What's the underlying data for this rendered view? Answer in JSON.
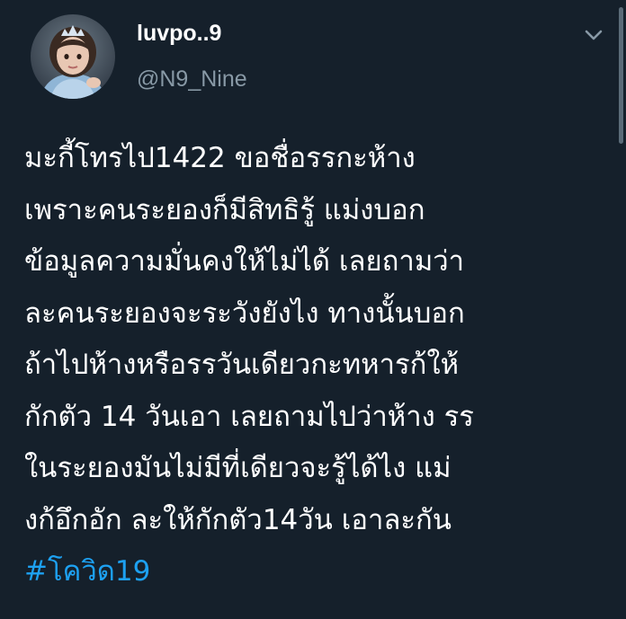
{
  "author": {
    "display_name": "luvpo..9",
    "handle": "@N9_Nine",
    "avatar_icon": "profile-photo"
  },
  "menu": {
    "icon": "chevron-down-icon"
  },
  "tweet": {
    "lines": [
      "มะกี้โทรไป1422 ขอชื่อรรกะห้าง",
      "เพราะคนระยองก็มีสิทธิรู้ แม่งบอก",
      "ข้อมูลความมั่นคงให้ไม่ได้ เลยถามว่า",
      "ละคนระยองจะระวังยังไง ทางนั้นบอก",
      "ถ้าไปห้างหรือรรวันเดียวกะทหารก้ให้",
      "กักตัว 14 วันเอา เลยถามไปว่าห้าง รร",
      "ในระยองมันไม่มีที่เดียวจะรู้ได้ไง แม่",
      "งก้อึกอัก ละให้กักตัว14วัน เอาละกัน"
    ],
    "hashtag": "#โควิด19"
  },
  "colors": {
    "background": "#15202b",
    "text": "#ffffff",
    "secondary_text": "#8899a6",
    "link": "#1da1f2"
  }
}
